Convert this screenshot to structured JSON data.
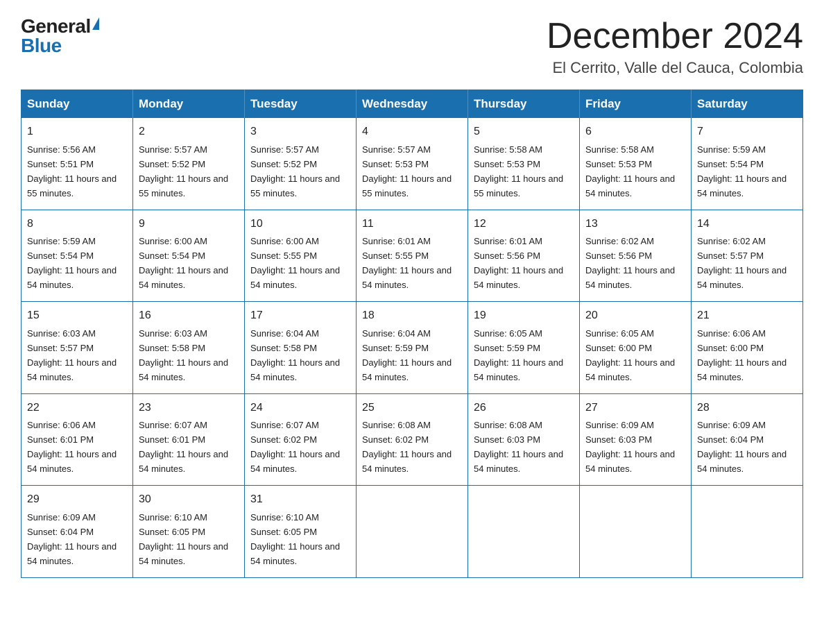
{
  "header": {
    "logo_general": "General",
    "logo_blue": "Blue",
    "month_title": "December 2024",
    "location": "El Cerrito, Valle del Cauca, Colombia"
  },
  "days_of_week": [
    "Sunday",
    "Monday",
    "Tuesday",
    "Wednesday",
    "Thursday",
    "Friday",
    "Saturday"
  ],
  "weeks": [
    [
      {
        "day": "1",
        "sunrise": "5:56 AM",
        "sunset": "5:51 PM",
        "daylight": "11 hours and 55 minutes."
      },
      {
        "day": "2",
        "sunrise": "5:57 AM",
        "sunset": "5:52 PM",
        "daylight": "11 hours and 55 minutes."
      },
      {
        "day": "3",
        "sunrise": "5:57 AM",
        "sunset": "5:52 PM",
        "daylight": "11 hours and 55 minutes."
      },
      {
        "day": "4",
        "sunrise": "5:57 AM",
        "sunset": "5:53 PM",
        "daylight": "11 hours and 55 minutes."
      },
      {
        "day": "5",
        "sunrise": "5:58 AM",
        "sunset": "5:53 PM",
        "daylight": "11 hours and 55 minutes."
      },
      {
        "day": "6",
        "sunrise": "5:58 AM",
        "sunset": "5:53 PM",
        "daylight": "11 hours and 54 minutes."
      },
      {
        "day": "7",
        "sunrise": "5:59 AM",
        "sunset": "5:54 PM",
        "daylight": "11 hours and 54 minutes."
      }
    ],
    [
      {
        "day": "8",
        "sunrise": "5:59 AM",
        "sunset": "5:54 PM",
        "daylight": "11 hours and 54 minutes."
      },
      {
        "day": "9",
        "sunrise": "6:00 AM",
        "sunset": "5:54 PM",
        "daylight": "11 hours and 54 minutes."
      },
      {
        "day": "10",
        "sunrise": "6:00 AM",
        "sunset": "5:55 PM",
        "daylight": "11 hours and 54 minutes."
      },
      {
        "day": "11",
        "sunrise": "6:01 AM",
        "sunset": "5:55 PM",
        "daylight": "11 hours and 54 minutes."
      },
      {
        "day": "12",
        "sunrise": "6:01 AM",
        "sunset": "5:56 PM",
        "daylight": "11 hours and 54 minutes."
      },
      {
        "day": "13",
        "sunrise": "6:02 AM",
        "sunset": "5:56 PM",
        "daylight": "11 hours and 54 minutes."
      },
      {
        "day": "14",
        "sunrise": "6:02 AM",
        "sunset": "5:57 PM",
        "daylight": "11 hours and 54 minutes."
      }
    ],
    [
      {
        "day": "15",
        "sunrise": "6:03 AM",
        "sunset": "5:57 PM",
        "daylight": "11 hours and 54 minutes."
      },
      {
        "day": "16",
        "sunrise": "6:03 AM",
        "sunset": "5:58 PM",
        "daylight": "11 hours and 54 minutes."
      },
      {
        "day": "17",
        "sunrise": "6:04 AM",
        "sunset": "5:58 PM",
        "daylight": "11 hours and 54 minutes."
      },
      {
        "day": "18",
        "sunrise": "6:04 AM",
        "sunset": "5:59 PM",
        "daylight": "11 hours and 54 minutes."
      },
      {
        "day": "19",
        "sunrise": "6:05 AM",
        "sunset": "5:59 PM",
        "daylight": "11 hours and 54 minutes."
      },
      {
        "day": "20",
        "sunrise": "6:05 AM",
        "sunset": "6:00 PM",
        "daylight": "11 hours and 54 minutes."
      },
      {
        "day": "21",
        "sunrise": "6:06 AM",
        "sunset": "6:00 PM",
        "daylight": "11 hours and 54 minutes."
      }
    ],
    [
      {
        "day": "22",
        "sunrise": "6:06 AM",
        "sunset": "6:01 PM",
        "daylight": "11 hours and 54 minutes."
      },
      {
        "day": "23",
        "sunrise": "6:07 AM",
        "sunset": "6:01 PM",
        "daylight": "11 hours and 54 minutes."
      },
      {
        "day": "24",
        "sunrise": "6:07 AM",
        "sunset": "6:02 PM",
        "daylight": "11 hours and 54 minutes."
      },
      {
        "day": "25",
        "sunrise": "6:08 AM",
        "sunset": "6:02 PM",
        "daylight": "11 hours and 54 minutes."
      },
      {
        "day": "26",
        "sunrise": "6:08 AM",
        "sunset": "6:03 PM",
        "daylight": "11 hours and 54 minutes."
      },
      {
        "day": "27",
        "sunrise": "6:09 AM",
        "sunset": "6:03 PM",
        "daylight": "11 hours and 54 minutes."
      },
      {
        "day": "28",
        "sunrise": "6:09 AM",
        "sunset": "6:04 PM",
        "daylight": "11 hours and 54 minutes."
      }
    ],
    [
      {
        "day": "29",
        "sunrise": "6:09 AM",
        "sunset": "6:04 PM",
        "daylight": "11 hours and 54 minutes."
      },
      {
        "day": "30",
        "sunrise": "6:10 AM",
        "sunset": "6:05 PM",
        "daylight": "11 hours and 54 minutes."
      },
      {
        "day": "31",
        "sunrise": "6:10 AM",
        "sunset": "6:05 PM",
        "daylight": "11 hours and 54 minutes."
      },
      null,
      null,
      null,
      null
    ]
  ]
}
